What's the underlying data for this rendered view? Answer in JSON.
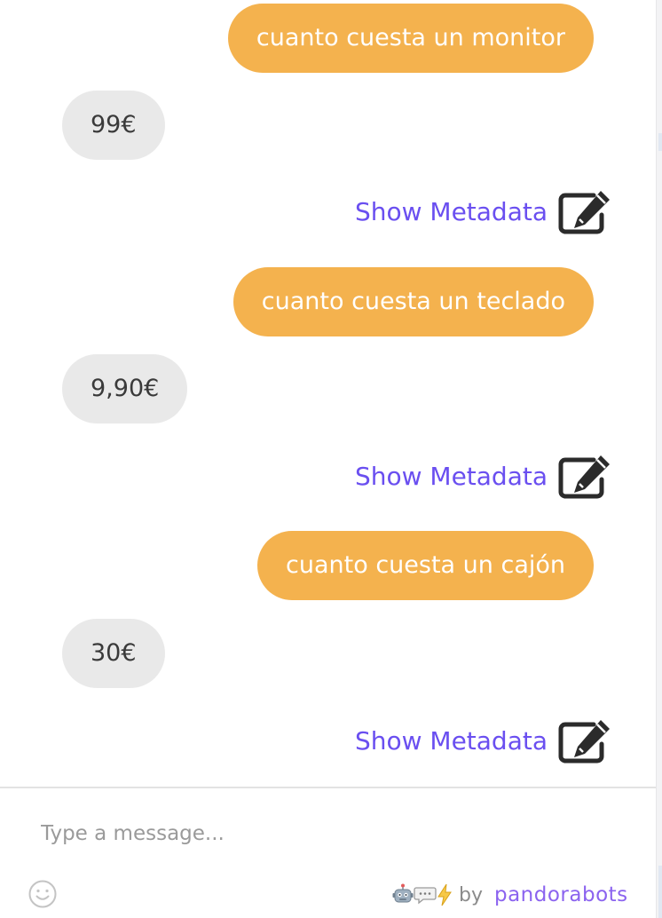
{
  "messages": [
    {
      "role": "user",
      "text": "cuanto cuesta un monitor"
    },
    {
      "role": "bot",
      "text": "99€"
    },
    {
      "role": "user",
      "text": "cuanto cuesta un teclado"
    },
    {
      "role": "bot",
      "text": "9,90€"
    },
    {
      "role": "user",
      "text": "cuanto cuesta un cajón"
    },
    {
      "role": "bot",
      "text": "30€"
    }
  ],
  "metadata_link_label": "Show Metadata",
  "composer": {
    "placeholder": "Type a message...",
    "value": ""
  },
  "footer": {
    "by_label": "by",
    "brand_name": "pandorabots"
  },
  "colors": {
    "user_bubble": "#f4b24e",
    "bot_bubble": "#e9e9e9",
    "link": "#6a4ff0",
    "brand": "#8b63ef"
  },
  "icons": {
    "metadata": "edit-square-icon",
    "emoji": "smiley-icon",
    "powered": [
      "robot-icon",
      "speech-bubble-icon",
      "lightning-icon"
    ]
  }
}
